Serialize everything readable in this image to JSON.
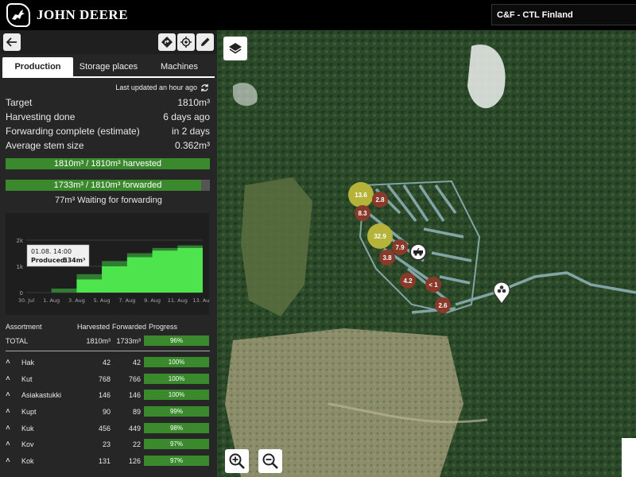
{
  "brand": {
    "name": "JOHN DEERE"
  },
  "org": {
    "selected": "C&F - CTL Finland"
  },
  "tabs": [
    "Production",
    "Storage places",
    "Machines"
  ],
  "updated": "Last updated an hour ago",
  "stats": [
    {
      "label": "Target",
      "value": "1810m³"
    },
    {
      "label": "Harvesting done",
      "value": "6 days ago"
    },
    {
      "label": "Forwarding complete (estimate)",
      "value": "in 2 days"
    },
    {
      "label": "Average stem size",
      "value": "0.362m³"
    }
  ],
  "harvest_bar": {
    "label": "1810m³ / 1810m³ harvested",
    "fraction": 1.0
  },
  "forward_bar": {
    "label": "1733m³ / 1810m³ forwarded",
    "fraction": 0.9575
  },
  "waiting": "77m³ Waiting for forwarding",
  "chart_data": {
    "type": "area",
    "x": [
      "30. Jul",
      "1. Aug",
      "3. Aug",
      "5. Aug",
      "7. Aug",
      "9. Aug",
      "11. Aug",
      "13. Aug"
    ],
    "ytick_labels": [
      "0",
      "1k",
      "2k"
    ],
    "ylim": [
      0,
      2000
    ],
    "series": [
      {
        "values": [
          0,
          150,
          700,
          1200,
          1500,
          1700,
          1800,
          1810
        ]
      },
      {
        "values": [
          0,
          0,
          500,
          1000,
          1350,
          1600,
          1700,
          1733
        ]
      }
    ],
    "tooltip": {
      "date": "01.08. 14:00",
      "label": "Produced:",
      "value": "534m³"
    },
    "colors": {
      "harvested": "#2e7d32",
      "forwarded": "#4ee44e"
    }
  },
  "table": {
    "headers": [
      "Assortment",
      "Harvested",
      "Forwarded",
      "Progress"
    ],
    "total": {
      "name": "TOTAL",
      "harvested": "1810m³",
      "forwarded": "1733m³",
      "progress": "96%"
    },
    "rows": [
      {
        "name": "Hak",
        "harvested": "42",
        "forwarded": "42",
        "progress": "100%"
      },
      {
        "name": "Kut",
        "harvested": "768",
        "forwarded": "766",
        "progress": "100%"
      },
      {
        "name": "Asiakastukki",
        "harvested": "146",
        "forwarded": "146",
        "progress": "100%"
      },
      {
        "name": "Kupt",
        "harvested": "90",
        "forwarded": "89",
        "progress": "99%"
      },
      {
        "name": "Kuk",
        "harvested": "456",
        "forwarded": "449",
        "progress": "98%"
      },
      {
        "name": "Kov",
        "harvested": "23",
        "forwarded": "22",
        "progress": "97%"
      },
      {
        "name": "Kok",
        "harvested": "131",
        "forwarded": "126",
        "progress": "97%"
      }
    ]
  },
  "map": {
    "pins": [
      {
        "label": "13.6",
        "kind": "large"
      },
      {
        "label": "2.8",
        "kind": "small"
      },
      {
        "label": "8.3",
        "kind": "small"
      },
      {
        "label": "32.9",
        "kind": "large"
      },
      {
        "label": "7.9",
        "kind": "small"
      },
      {
        "label": "3.8",
        "kind": "small"
      },
      {
        "label": "4.2",
        "kind": "small"
      },
      {
        "label": "< 1",
        "kind": "small"
      },
      {
        "label": "2.6",
        "kind": "small"
      }
    ]
  },
  "colors": {
    "accent": "#3a8a2d",
    "pin_brown": "#8a3a2a",
    "pin_yellow": "#b5b33a"
  }
}
